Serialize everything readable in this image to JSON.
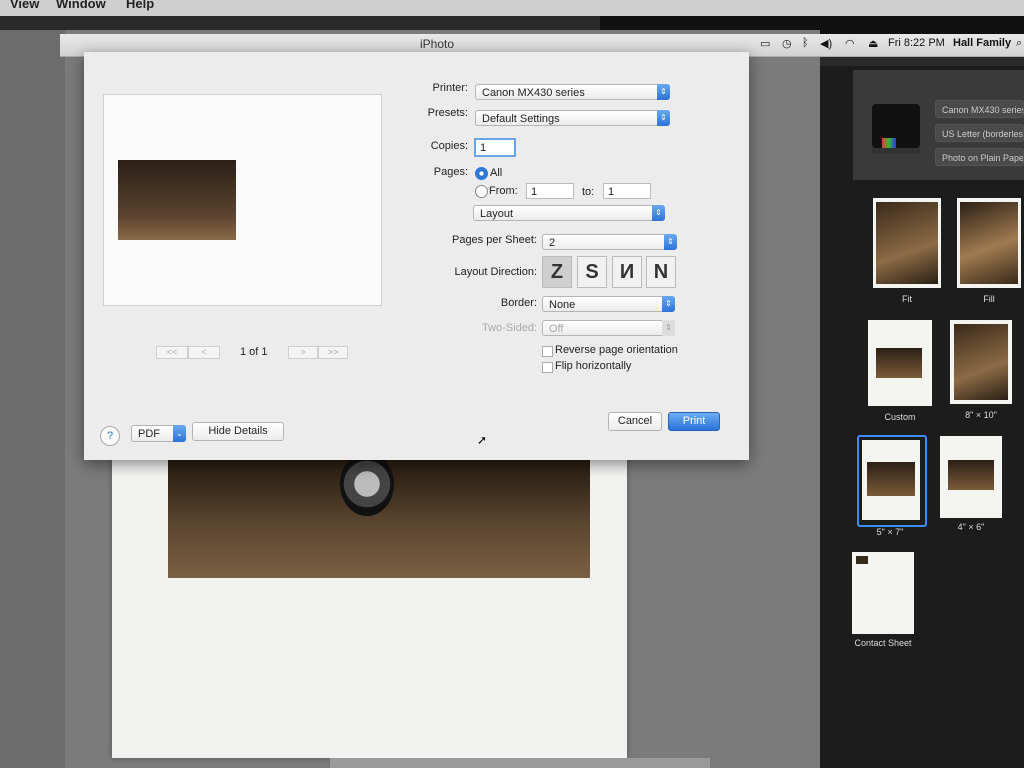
{
  "menubar": {
    "items": [
      "View",
      "Window",
      "Help"
    ]
  },
  "window": {
    "title": "iPhoto"
  },
  "status": {
    "time": "Fri 8:22 PM",
    "user": "Hall Family"
  },
  "dialog": {
    "printer_label": "Printer:",
    "printer_value": "Canon MX430 series",
    "presets_label": "Presets:",
    "presets_value": "Default Settings",
    "copies_label": "Copies:",
    "copies_value": "1",
    "pages_label": "Pages:",
    "pages_all": "All",
    "pages_from": "From:",
    "from_value": "1",
    "to_label": "to:",
    "to_value": "1",
    "section_value": "Layout",
    "pps_label": "Pages per Sheet:",
    "pps_value": "2",
    "layout_dir_label": "Layout Direction:",
    "border_label": "Border:",
    "border_value": "None",
    "two_sided_label": "Two-Sided:",
    "two_sided_value": "Off",
    "reverse_label": "Reverse page orientation",
    "flip_label": "Flip horizontally",
    "page_counter": "1 of 1",
    "help_label": "?",
    "pdf_label": "PDF",
    "hide_details_label": "Hide Details",
    "cancel_label": "Cancel",
    "print_label": "Print"
  },
  "right_panel": {
    "printer_button": "Canon MX430 series",
    "paper_button": "US Letter (borderless)",
    "media_button": "Photo on Plain Paper",
    "tiles": [
      "Fit",
      "Fill",
      "Custom",
      "8\" × 10\"",
      "5\" × 7\"",
      "4\" × 6\"",
      "Contact Sheet"
    ]
  },
  "colors": {
    "accent": "#2f78d8",
    "panel": "#1c1c1c",
    "sheet": "#ececec"
  }
}
